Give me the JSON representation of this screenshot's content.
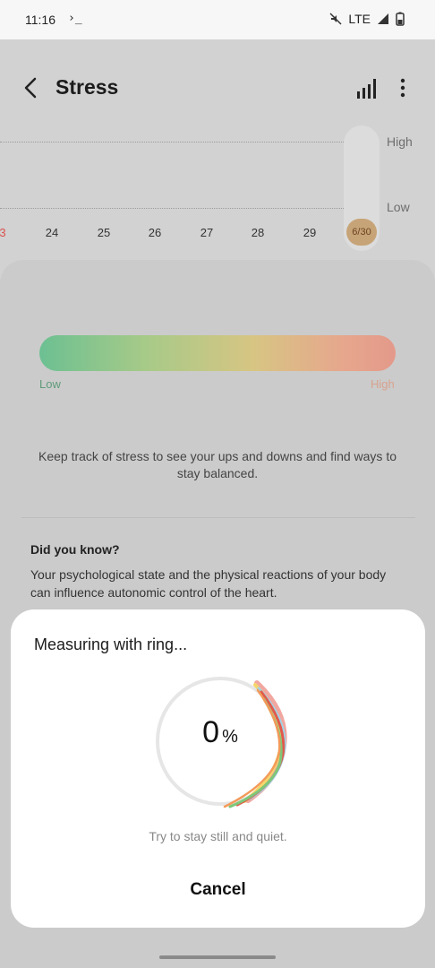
{
  "status_bar": {
    "time": "11:16",
    "terminal_glyph": "›_",
    "network": "LTE"
  },
  "app_bar": {
    "title": "Stress"
  },
  "chart": {
    "y_labels": {
      "high": "High",
      "low": "Low"
    },
    "dates": [
      "3",
      "24",
      "25",
      "26",
      "27",
      "28",
      "29"
    ],
    "selected_date": "6/30"
  },
  "stress_scale": {
    "low_label": "Low",
    "high_label": "High"
  },
  "description": "Keep track of stress to see your ups and downs and find ways to stay balanced.",
  "did_you_know": {
    "title": "Did you know?",
    "body": "Your psychological state and the physical reactions of your body can influence autonomic control of the heart."
  },
  "measure_sheet": {
    "title": "Measuring with ring...",
    "progress_value": "0",
    "progress_unit": "%",
    "hint": "Try to stay still and quiet.",
    "cancel_label": "Cancel"
  },
  "colors": {
    "low": "#6cc092",
    "high": "#e4998a",
    "selected_badge": "#c7a478"
  }
}
